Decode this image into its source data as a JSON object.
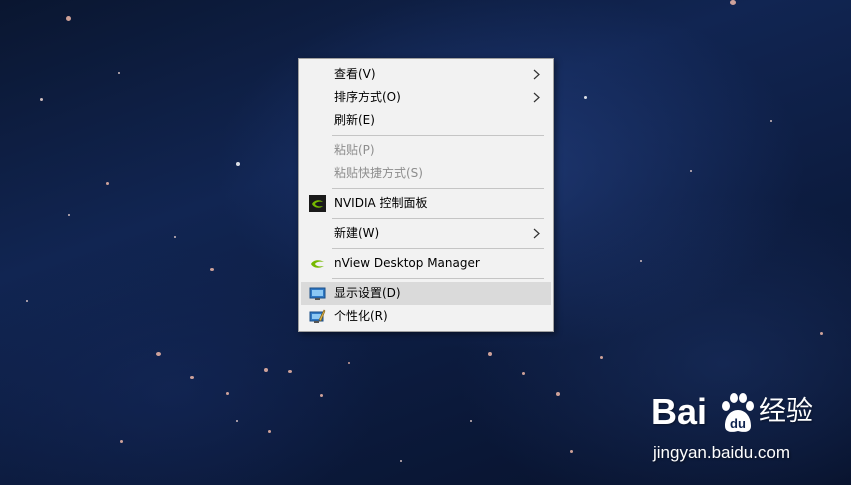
{
  "context_menu": {
    "items": [
      {
        "label": "查看(V)",
        "has_submenu": true,
        "enabled": true
      },
      {
        "label": "排序方式(O)",
        "has_submenu": true,
        "enabled": true
      },
      {
        "label": "刷新(E)",
        "has_submenu": false,
        "enabled": true
      },
      {
        "label": "粘贴(P)",
        "has_submenu": false,
        "enabled": false
      },
      {
        "label": "粘贴快捷方式(S)",
        "has_submenu": false,
        "enabled": false
      },
      {
        "label": "NVIDIA 控制面板",
        "icon": "nvidia-icon",
        "enabled": true
      },
      {
        "label": "新建(W)",
        "has_submenu": true,
        "enabled": true
      },
      {
        "label": "nView Desktop Manager",
        "icon": "nview-icon",
        "enabled": true
      },
      {
        "label": "显示设置(D)",
        "icon": "display-icon",
        "enabled": true,
        "highlighted": true
      },
      {
        "label": "个性化(R)",
        "icon": "personalize-icon",
        "enabled": true
      }
    ],
    "colors": {
      "background": "#f2f2f2",
      "highlight": "#dadada",
      "disabled_text": "#8d8d8d"
    }
  },
  "watermark": {
    "brand": "Bai",
    "brand_suffix": "du",
    "cn": "经验",
    "url": "jingyan.baidu.com"
  }
}
